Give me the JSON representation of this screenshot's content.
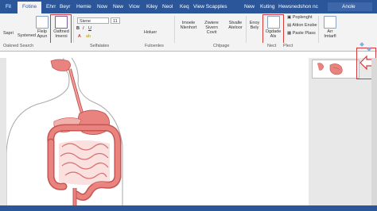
{
  "tabs": [
    "Fil",
    "Fotine",
    "Ehrr",
    "Beyr",
    "Hemie",
    "Now",
    "New",
    "Vicw",
    "Kiley",
    "Neol",
    "Keq",
    "View Scapples",
    "New",
    "Kuting",
    "Hewsnedshon nc",
    "Anole"
  ],
  "active_tab": 1,
  "ribbon": {
    "sapri": "Sapri",
    "systened": "Systened",
    "flelp_apun": [
      "Flelp",
      "Apun"
    ],
    "oaftned_imeroi": [
      "Oaftned",
      "Imeroi"
    ],
    "font_name": "Siene",
    "font_size": "11",
    "holuer": "Holuer",
    "imoele_nlenhort": [
      "Imoele",
      "Nlenhort"
    ],
    "ziwiere_sivern_covit": [
      "Ziwiere Sivern",
      "Covit"
    ],
    "stvalle_ateloor": [
      "Stvalle",
      "Ateloor"
    ],
    "enoy_bely": [
      "Enoy",
      "Bely"
    ],
    "ogdade_als": [
      "Ogdade",
      "Als"
    ],
    "poplenght": "Poplenght",
    "attion_ensbe": "Attion Ensbe",
    "paste_plass": "Paste Plass",
    "arr_imtarfl": [
      "Arr",
      "Imtarfl"
    ]
  },
  "group_labels": {
    "oakned_search": "Oakned Search",
    "selfalates": "Selfalates",
    "fuloenles": "Fuloenles",
    "chlpage": "Chlpage",
    "nect": "Nect",
    "plect": "Plect"
  },
  "colors": {
    "title_blue": "#2b579a",
    "highlight_red": "#d63a3a",
    "organ_pink": "#e8837f",
    "organ_stroke": "#c75450"
  }
}
